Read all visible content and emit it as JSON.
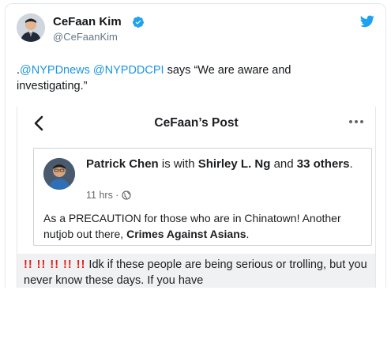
{
  "tweet": {
    "author_name": "CeFaan Kim",
    "author_handle": "@CeFaanKim",
    "text_prefix": ".",
    "mention_1": "@NYPDnews",
    "mention_2": "@NYPDDCPI",
    "text_suffix": " says “We are aware and investigating.”"
  },
  "icons": {
    "verified": "verified-badge-icon",
    "bird": "twitter-bird-icon",
    "back": "chevron-left-icon",
    "more": "more-dots-icon",
    "globe": "globe-icon"
  },
  "embedded_post": {
    "page_title": "CeFaan’s Post",
    "author": "Patrick Chen",
    "with_text": " is with ",
    "tagged": "Shirley L. Ng",
    "and_text": " and ",
    "others": "33 others",
    "period": ".",
    "time": "11 hrs ·",
    "body_1": "As a PRECAUTION for those who are in Chinatown! Another nutjob out there, ",
    "body_bold": "Crimes Against Asians",
    "body_end": ".",
    "comment_bangs": "‼️‼️‼️‼️‼️",
    "comment_bangs_text": "!! !! !! !! !!",
    "comment_text": " Idk if these people are being serious or trolling, but you never know these days. If you have"
  },
  "colors": {
    "link": "#1b95e0",
    "verified": "#1da1f2",
    "bangs": "#e0201b"
  }
}
